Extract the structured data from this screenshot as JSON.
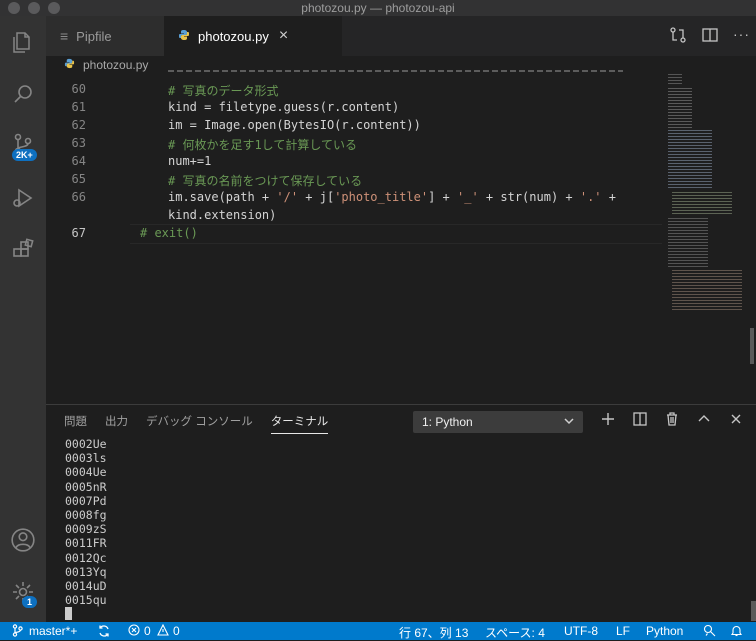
{
  "window": {
    "title": "photozou.py — photozou-api"
  },
  "activity_bar": {
    "scm_badge": "2K+",
    "settings_badge": "1"
  },
  "tabs": [
    {
      "label": "Pipfile"
    },
    {
      "label": "photozou.py",
      "close": "×"
    }
  ],
  "breadcrumb": {
    "file": "photozou.py"
  },
  "editor": {
    "lines": [
      {
        "num": "60",
        "text": "# 写真のデータ形式"
      },
      {
        "num": "61",
        "text": "kind = filetype.guess(r.content)"
      },
      {
        "num": "62",
        "text": "im = Image.open(BytesIO(r.content))"
      },
      {
        "num": "63",
        "text": "# 何枚かを足す1して計算している"
      },
      {
        "num": "64",
        "text": "num+=1"
      },
      {
        "num": "65",
        "text": "# 写真の名前をつけて保存している"
      },
      {
        "num": "66",
        "text_a": "im.save(path + ",
        "str1": "'/'",
        "text_b": " + j[",
        "str2": "'photo_title'",
        "text_c": "] + ",
        "str3": "'_'",
        "text_d": " + str(num) + ",
        "str4": "'.'",
        "text_e": " +"
      },
      {
        "num": "",
        "text": "kind.extension)"
      },
      {
        "num": "67",
        "text": "# exit()"
      }
    ]
  },
  "panel": {
    "tabs": [
      "問題",
      "出力",
      "デバッグ コンソール",
      "ターミナル"
    ],
    "terminal_select": "1: Python",
    "terminal_lines": [
      "0002Ue",
      "0003ls",
      "0004Ue",
      "0005nR",
      "0007Pd",
      "0008fg",
      "0009zS",
      "0011FR",
      "0012Qc",
      "0013Yq",
      "0014uD",
      "0015qu"
    ]
  },
  "status_bar": {
    "branch": "master*+",
    "errors": "0",
    "warnings": "0",
    "position": "行 67、列 13",
    "spaces": "スペース: 4",
    "encoding": "UTF-8",
    "eol": "LF",
    "language": "Python"
  },
  "colors": {
    "status_bar": "#007acc",
    "comment": "#6a9955",
    "string": "#ce9178"
  }
}
